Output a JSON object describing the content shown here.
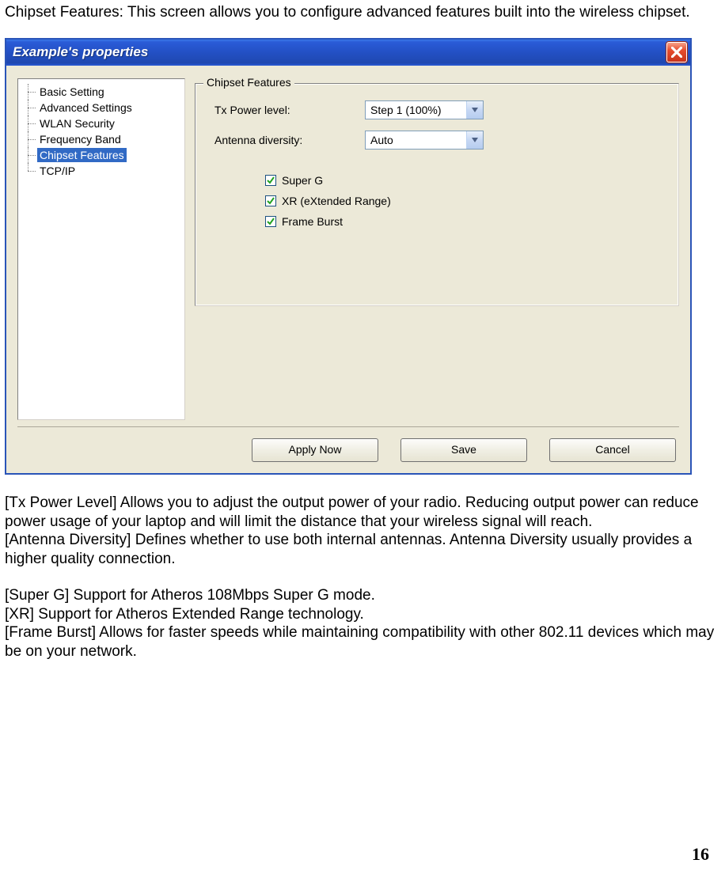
{
  "intro": "Chipset Features: This screen allows you to configure advanced features built into the wireless chipset.",
  "window": {
    "title": "Example's properties",
    "tree": [
      {
        "label": "Basic Setting",
        "selected": false
      },
      {
        "label": "Advanced Settings",
        "selected": false
      },
      {
        "label": "WLAN Security",
        "selected": false
      },
      {
        "label": "Frequency Band",
        "selected": false
      },
      {
        "label": "Chipset Features",
        "selected": true
      },
      {
        "label": "TCP/IP",
        "selected": false
      }
    ],
    "group": {
      "title": "Chipset Features",
      "tx_label": "Tx Power level:",
      "tx_value": "Step 1 (100%)",
      "ant_label": "Antenna diversity:",
      "ant_value": "Auto",
      "checks": [
        {
          "label": "Super G",
          "checked": true
        },
        {
          "label": "XR (eXtended Range)",
          "checked": true
        },
        {
          "label": "Frame Burst",
          "checked": true
        }
      ]
    },
    "buttons": {
      "apply": "Apply Now",
      "save": "Save",
      "cancel": "Cancel"
    }
  },
  "desc": {
    "p1": "[Tx Power Level] Allows you to adjust the output power of your radio. Reducing output power can reduce power usage of your laptop and will limit the distance that your wireless signal will reach.",
    "p2": "[Antenna Diversity] Defines whether to use both internal antennas. Antenna Diversity usually provides a higher quality connection.",
    "p3": "[Super G] Support for Atheros 108Mbps Super G mode.",
    "p4": "[XR] Support for Atheros Extended Range technology.",
    "p5": "[Frame Burst] Allows for faster speeds while maintaining compatibility with other 802.11 devices which may be on your network."
  },
  "page_number": "16"
}
